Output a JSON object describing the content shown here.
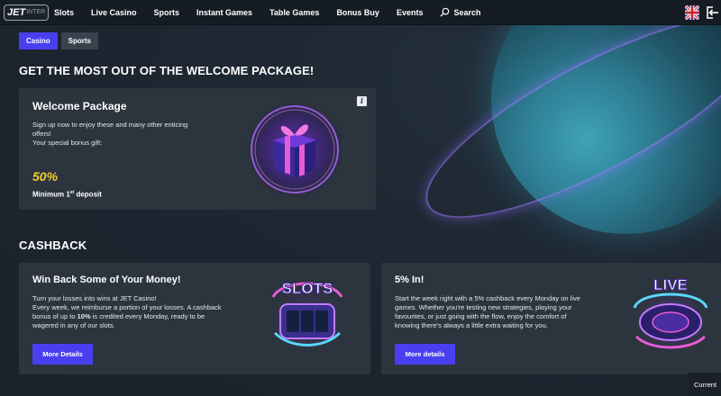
{
  "nav": {
    "items": [
      "Slots",
      "Live Casino",
      "Sports",
      "Instant Games",
      "Table Games",
      "Bonus Buy",
      "Events"
    ],
    "search_label": "Search"
  },
  "logo": {
    "main": "JET",
    "sub": "INTER"
  },
  "tabs": [
    {
      "label": "Casino",
      "active": true
    },
    {
      "label": "Sports",
      "active": false
    }
  ],
  "welcome": {
    "heading": "GET THE MOST OUT OF THE WELCOME PACKAGE!",
    "card_title": "Welcome Package",
    "line1": "Sign up now to enjoy these and many other enticing",
    "line2": "offers!",
    "line3": "Your special bonus gift:",
    "percent": "50%",
    "min_pre": "Minimum 1",
    "min_sup": "st",
    "min_post": " deposit",
    "info_glyph": "i"
  },
  "cashback": {
    "heading": "CASHBACK",
    "slots_card": {
      "title": "Win Back Some of Your Money!",
      "line1": "Turn your losses into wins at JET Casino!",
      "line2": "Every week, we reimburse a portion of your losses. A cashback",
      "line3_pre": "bonus of up to ",
      "line3_bold": "10%",
      "line3_post": " is credited every Monday, ready to be",
      "line4": "wagered in any of our slots.",
      "button": "More Details",
      "badge": "SLOTS"
    },
    "live_card": {
      "title": "5% In!",
      "line1": "Start the week right with a 5% cashback every Monday on live",
      "line2": "games. Whether you're testing new strategies, playing your",
      "line3": "favourites, or just going with the flow, enjoy the comfort of",
      "line4": "knowing there's always a little extra waiting for you.",
      "button": "More details",
      "badge": "LIVE"
    }
  },
  "footer": {
    "current_label": "Current"
  },
  "colors": {
    "accent": "#4a3ff0",
    "gold": "#f2d02c",
    "card": "#2c343e"
  }
}
